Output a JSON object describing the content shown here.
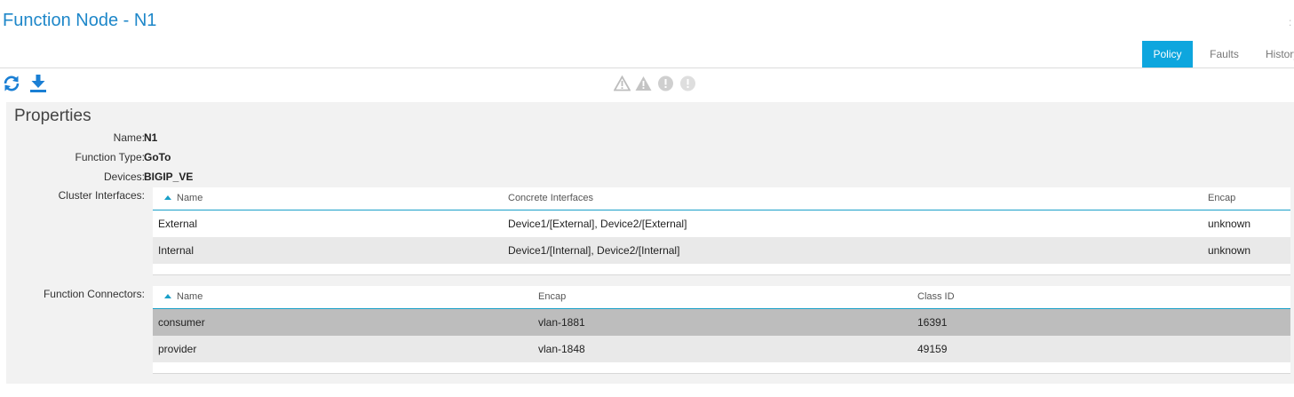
{
  "window": {
    "title": "Function Node - N1"
  },
  "tabs": [
    {
      "label": "Policy",
      "active": true
    },
    {
      "label": "Faults",
      "active": false
    },
    {
      "label": "History",
      "active": false
    }
  ],
  "toolbar": {
    "icons": [
      "refresh-icon",
      "download-icon"
    ]
  },
  "fault_summary": {
    "icons": [
      "critical-warning-icon",
      "major-warning-icon",
      "minor-alert-icon",
      "info-alert-icon"
    ]
  },
  "properties": {
    "heading": "Properties",
    "name": {
      "label": "Name:",
      "value": "N1"
    },
    "function_type": {
      "label": "Function Type:",
      "value": "GoTo"
    },
    "devices": {
      "label": "Devices:",
      "value": "BIGIP_VE"
    },
    "cluster_interfaces": {
      "label": "Cluster Interfaces:",
      "columns": [
        "Name",
        "Concrete Interfaces",
        "Encap"
      ],
      "rows": [
        [
          "External",
          "Device1/[External], Device2/[External]",
          "unknown"
        ],
        [
          "Internal",
          "Device1/[Internal], Device2/[Internal]",
          "unknown"
        ]
      ]
    },
    "function_connectors": {
      "label": "Function Connectors:",
      "columns": [
        "Name",
        "Encap",
        "Class ID"
      ],
      "rows": [
        [
          "consumer",
          "vlan-1881",
          "16391"
        ],
        [
          "provider",
          "vlan-1848",
          "49159"
        ]
      ]
    }
  },
  "colors": {
    "accent": "#0ea6de",
    "title": "#1e87c9",
    "icon": "#1a7fd4"
  }
}
